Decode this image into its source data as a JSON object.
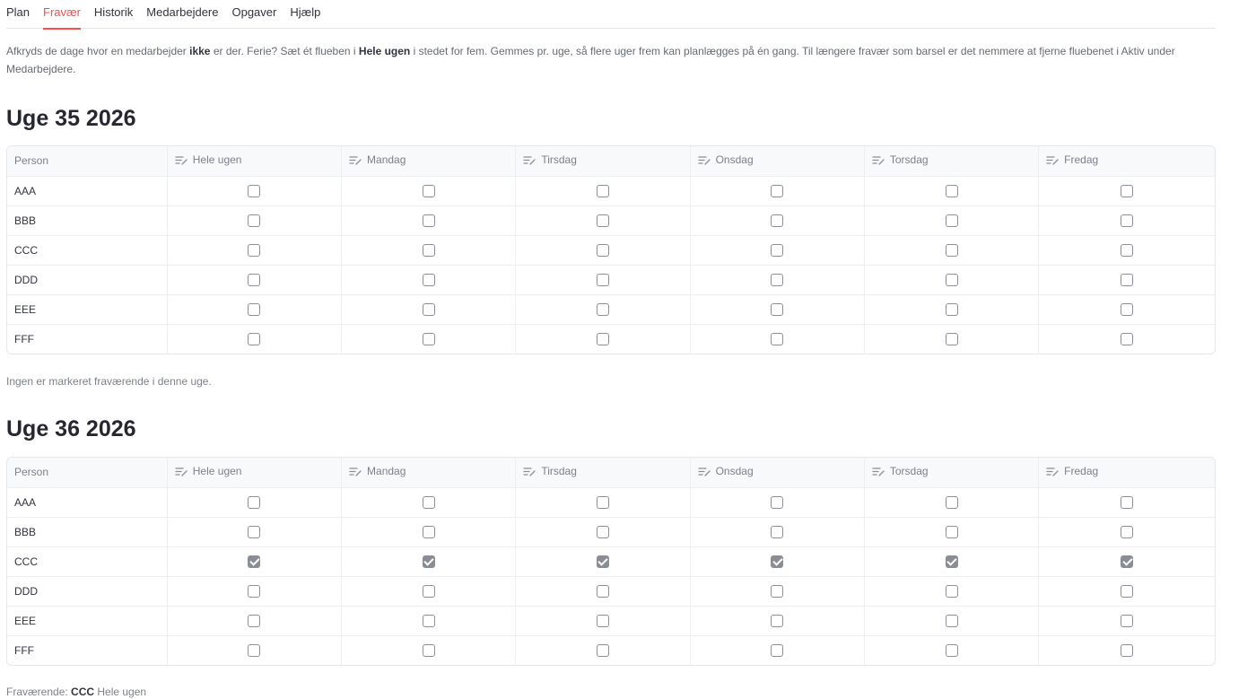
{
  "tabs": [
    "Plan",
    "Fravær",
    "Historik",
    "Medarbejdere",
    "Opgaver",
    "Hjælp"
  ],
  "intro": {
    "p1": "Afkryds de dage hvor en medarbejder ",
    "b1": "ikke",
    "p2": " er der. Ferie? Sæt ét flueben i ",
    "b2": "Hele ugen",
    "p3": " i stedet for fem. Gemmes pr. uge, så flere uger frem kan planlægges på én gang. Til længere fravær som barsel er det nemmere at fjerne fluebenet i Aktiv under Medarbejdere."
  },
  "columns": [
    "Person",
    "Hele ugen",
    "Mandag",
    "Tirsdag",
    "Onsdag",
    "Torsdag",
    "Fredag"
  ],
  "weeks": [
    {
      "title": "Uge 35 2026",
      "rows": [
        {
          "name": "AAA",
          "checks": [
            false,
            false,
            false,
            false,
            false,
            false
          ]
        },
        {
          "name": "BBB",
          "checks": [
            false,
            false,
            false,
            false,
            false,
            false
          ]
        },
        {
          "name": "CCC",
          "checks": [
            false,
            false,
            false,
            false,
            false,
            false
          ]
        },
        {
          "name": "DDD",
          "checks": [
            false,
            false,
            false,
            false,
            false,
            false
          ]
        },
        {
          "name": "EEE",
          "checks": [
            false,
            false,
            false,
            false,
            false,
            false
          ]
        },
        {
          "name": "FFF",
          "checks": [
            false,
            false,
            false,
            false,
            false,
            false
          ]
        }
      ],
      "summary": {
        "text": "Ingen er markeret fraværende i denne uge.",
        "prefix": "",
        "person": "",
        "suffix": ""
      }
    },
    {
      "title": "Uge 36 2026",
      "rows": [
        {
          "name": "AAA",
          "checks": [
            false,
            false,
            false,
            false,
            false,
            false
          ]
        },
        {
          "name": "BBB",
          "checks": [
            false,
            false,
            false,
            false,
            false,
            false
          ]
        },
        {
          "name": "CCC",
          "checks": [
            true,
            true,
            true,
            true,
            true,
            true
          ]
        },
        {
          "name": "DDD",
          "checks": [
            false,
            false,
            false,
            false,
            false,
            false
          ]
        },
        {
          "name": "EEE",
          "checks": [
            false,
            false,
            false,
            false,
            false,
            false
          ]
        },
        {
          "name": "FFF",
          "checks": [
            false,
            false,
            false,
            false,
            false,
            false
          ]
        }
      ],
      "summary": {
        "text": "",
        "prefix": "Fraværende: ",
        "person": "CCC",
        "suffix": " Hele ugen"
      }
    }
  ]
}
